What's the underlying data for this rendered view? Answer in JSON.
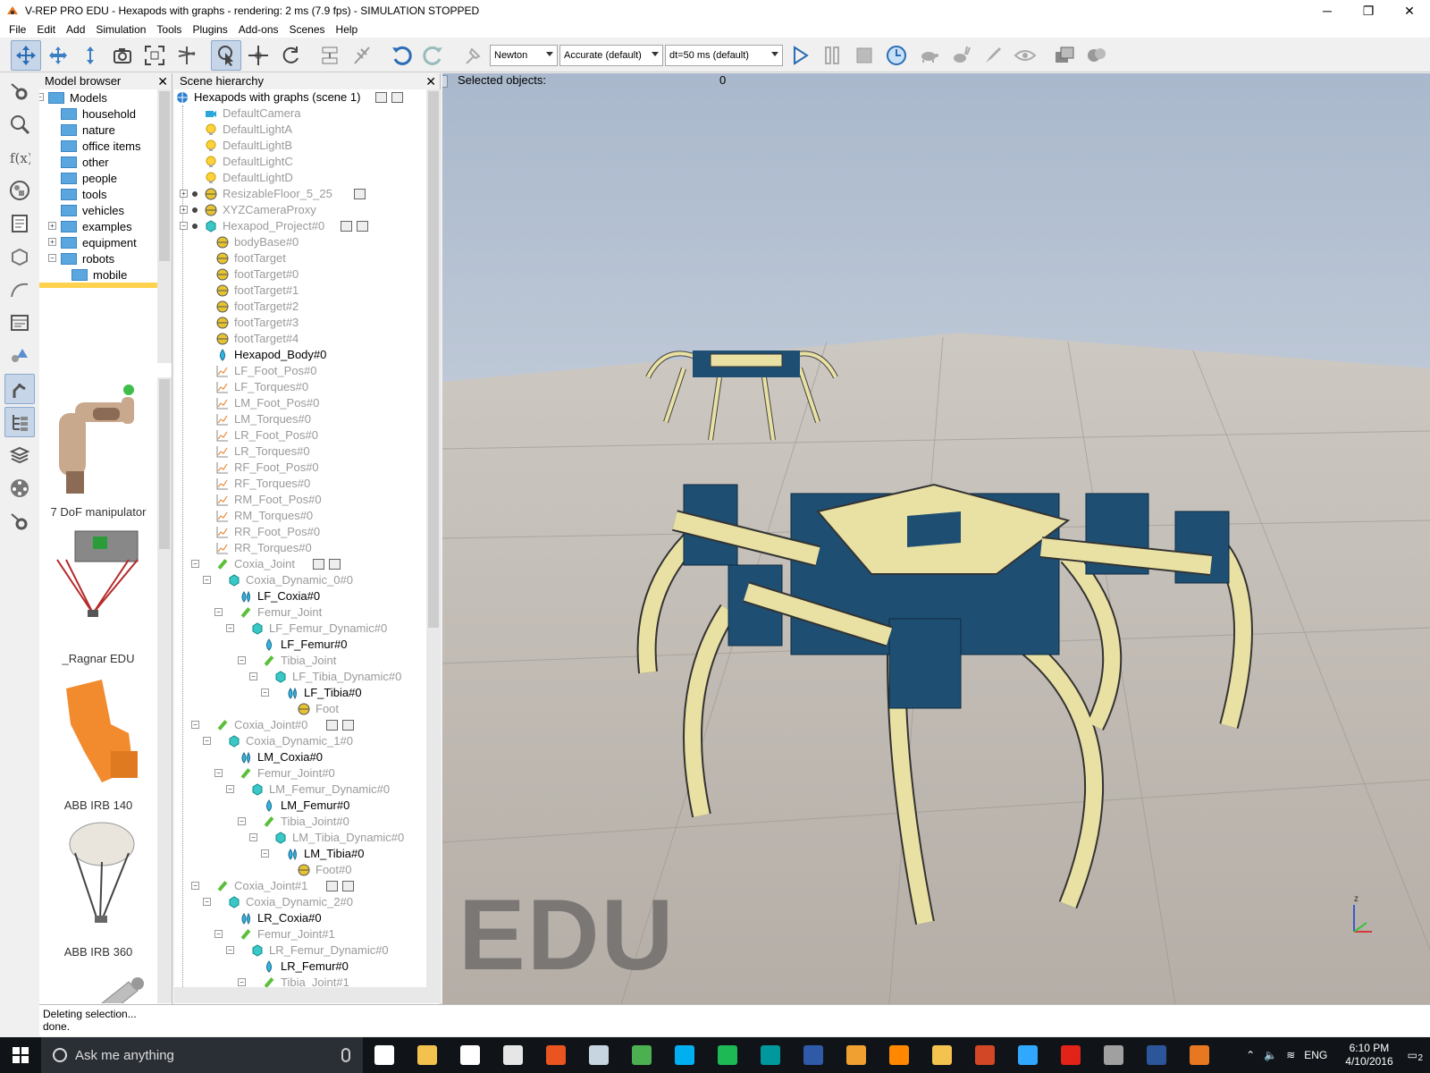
{
  "window": {
    "title": "V-REP PRO EDU - Hexapods with graphs - rendering: 2 ms (7.9 fps) - SIMULATION STOPPED",
    "minimize": "─",
    "maximize": "❐",
    "close": "✕"
  },
  "menu": [
    "File",
    "Edit",
    "Add",
    "Simulation",
    "Tools",
    "Plugins",
    "Add-ons",
    "Scenes",
    "Help"
  ],
  "toolbar": {
    "engine": "Newton",
    "accuracy": "Accurate (default)",
    "timestep": "dt=50 ms (default)"
  },
  "model_browser": {
    "title": "Model browser",
    "close": "✕",
    "tree": [
      {
        "label": "Models",
        "expander": "−"
      },
      {
        "label": "household"
      },
      {
        "label": "nature"
      },
      {
        "label": "office items"
      },
      {
        "label": "other"
      },
      {
        "label": "people"
      },
      {
        "label": "tools"
      },
      {
        "label": "vehicles"
      },
      {
        "label": "examples",
        "expander": "+"
      },
      {
        "label": "equipment",
        "expander": "+"
      },
      {
        "label": "robots",
        "expander": "−"
      },
      {
        "label": "mobile"
      }
    ],
    "models": [
      {
        "label": "7 DoF manipulator"
      },
      {
        "label": "_Ragnar EDU"
      },
      {
        "label": "ABB IRB 140"
      },
      {
        "label": "ABB IRB 360"
      },
      {
        "label": ""
      }
    ]
  },
  "hierarchy": {
    "title": "Scene hierarchy",
    "close": "✕",
    "scene_label": "Hexapods with graphs (scene 1)",
    "rows": [
      {
        "label": "DefaultCamera",
        "depth": 1,
        "icon": "camera",
        "dim": true
      },
      {
        "label": "DefaultLightA",
        "depth": 1,
        "icon": "light",
        "dim": true
      },
      {
        "label": "DefaultLightB",
        "depth": 1,
        "icon": "light",
        "dim": true
      },
      {
        "label": "DefaultLightC",
        "depth": 1,
        "icon": "light",
        "dim": true
      },
      {
        "label": "DefaultLightD",
        "depth": 1,
        "icon": "light",
        "dim": true
      },
      {
        "label": "ResizableFloor_5_25",
        "depth": 1,
        "icon": "dummy",
        "dim": true,
        "exp": "+",
        "dot": true,
        "badges": 1
      },
      {
        "label": "XYZCameraProxy",
        "depth": 1,
        "icon": "dummy",
        "dim": true,
        "exp": "+",
        "dot": true
      },
      {
        "label": "Hexapod_Project#0",
        "depth": 1,
        "icon": "shape",
        "dim": true,
        "exp": "−",
        "dot": true,
        "badges": 2
      },
      {
        "label": "bodyBase#0",
        "depth": 2,
        "icon": "dummy",
        "dim": true
      },
      {
        "label": "footTarget",
        "depth": 2,
        "icon": "dummy",
        "dim": true
      },
      {
        "label": "footTarget#0",
        "depth": 2,
        "icon": "dummy",
        "dim": true
      },
      {
        "label": "footTarget#1",
        "depth": 2,
        "icon": "dummy",
        "dim": true
      },
      {
        "label": "footTarget#2",
        "depth": 2,
        "icon": "dummy",
        "dim": true
      },
      {
        "label": "footTarget#3",
        "depth": 2,
        "icon": "dummy",
        "dim": true
      },
      {
        "label": "footTarget#4",
        "depth": 2,
        "icon": "dummy",
        "dim": true
      },
      {
        "label": "Hexapod_Body#0",
        "depth": 2,
        "icon": "drop",
        "dim": false
      },
      {
        "label": "LF_Foot_Pos#0",
        "depth": 2,
        "icon": "graph",
        "dim": true
      },
      {
        "label": "LF_Torques#0",
        "depth": 2,
        "icon": "graph",
        "dim": true
      },
      {
        "label": "LM_Foot_Pos#0",
        "depth": 2,
        "icon": "graph",
        "dim": true
      },
      {
        "label": "LM_Torques#0",
        "depth": 2,
        "icon": "graph",
        "dim": true
      },
      {
        "label": "LR_Foot_Pos#0",
        "depth": 2,
        "icon": "graph",
        "dim": true
      },
      {
        "label": "LR_Torques#0",
        "depth": 2,
        "icon": "graph",
        "dim": true
      },
      {
        "label": "RF_Foot_Pos#0",
        "depth": 2,
        "icon": "graph",
        "dim": true
      },
      {
        "label": "RF_Torques#0",
        "depth": 2,
        "icon": "graph",
        "dim": true
      },
      {
        "label": "RM_Foot_Pos#0",
        "depth": 2,
        "icon": "graph",
        "dim": true
      },
      {
        "label": "RM_Torques#0",
        "depth": 2,
        "icon": "graph",
        "dim": true
      },
      {
        "label": "RR_Foot_Pos#0",
        "depth": 2,
        "icon": "graph",
        "dim": true
      },
      {
        "label": "RR_Torques#0",
        "depth": 2,
        "icon": "graph",
        "dim": true
      },
      {
        "label": "Coxia_Joint",
        "depth": 2,
        "icon": "joint",
        "dim": true,
        "exp": "−",
        "badges": 2
      },
      {
        "label": "Coxia_Dynamic_0#0",
        "depth": 3,
        "icon": "shape",
        "dim": true,
        "exp": "−"
      },
      {
        "label": "LF_Coxia#0",
        "depth": 4,
        "icon": "drops",
        "dim": false
      },
      {
        "label": "Femur_Joint",
        "depth": 4,
        "icon": "joint",
        "dim": true,
        "exp": "−"
      },
      {
        "label": "LF_Femur_Dynamic#0",
        "depth": 5,
        "icon": "shape",
        "dim": true,
        "exp": "−"
      },
      {
        "label": "LF_Femur#0",
        "depth": 6,
        "icon": "drop",
        "dim": false
      },
      {
        "label": "Tibia_Joint",
        "depth": 6,
        "icon": "joint",
        "dim": true,
        "exp": "−"
      },
      {
        "label": "LF_Tibia_Dynamic#0",
        "depth": 7,
        "icon": "shape",
        "dim": true,
        "exp": "−"
      },
      {
        "label": "LF_Tibia#0",
        "depth": 8,
        "icon": "drops",
        "dim": false,
        "exp": "−"
      },
      {
        "label": "Foot",
        "depth": 9,
        "icon": "dummy",
        "dim": true
      },
      {
        "label": "Coxia_Joint#0",
        "depth": 2,
        "icon": "joint",
        "dim": true,
        "exp": "−",
        "badges": 2
      },
      {
        "label": "Coxia_Dynamic_1#0",
        "depth": 3,
        "icon": "shape",
        "dim": true,
        "exp": "−"
      },
      {
        "label": "LM_Coxia#0",
        "depth": 4,
        "icon": "drops",
        "dim": false
      },
      {
        "label": "Femur_Joint#0",
        "depth": 4,
        "icon": "joint",
        "dim": true,
        "exp": "−"
      },
      {
        "label": "LM_Femur_Dynamic#0",
        "depth": 5,
        "icon": "shape",
        "dim": true,
        "exp": "−"
      },
      {
        "label": "LM_Femur#0",
        "depth": 6,
        "icon": "drop",
        "dim": false
      },
      {
        "label": "Tibia_Joint#0",
        "depth": 6,
        "icon": "joint",
        "dim": true,
        "exp": "−"
      },
      {
        "label": "LM_Tibia_Dynamic#0",
        "depth": 7,
        "icon": "shape",
        "dim": true,
        "exp": "−"
      },
      {
        "label": "LM_Tibia#0",
        "depth": 8,
        "icon": "drops",
        "dim": false,
        "exp": "−"
      },
      {
        "label": "Foot#0",
        "depth": 9,
        "icon": "dummy",
        "dim": true
      },
      {
        "label": "Coxia_Joint#1",
        "depth": 2,
        "icon": "joint",
        "dim": true,
        "exp": "−",
        "badges": 2
      },
      {
        "label": "Coxia_Dynamic_2#0",
        "depth": 3,
        "icon": "shape",
        "dim": true,
        "exp": "−"
      },
      {
        "label": "LR_Coxia#0",
        "depth": 4,
        "icon": "drops",
        "dim": false
      },
      {
        "label": "Femur_Joint#1",
        "depth": 4,
        "icon": "joint",
        "dim": true,
        "exp": "−"
      },
      {
        "label": "LR_Femur_Dynamic#0",
        "depth": 5,
        "icon": "shape",
        "dim": true,
        "exp": "−"
      },
      {
        "label": "LR_Femur#0",
        "depth": 6,
        "icon": "drop",
        "dim": false
      },
      {
        "label": "Tibia_Joint#1",
        "depth": 6,
        "icon": "joint",
        "dim": true,
        "exp": "−"
      }
    ]
  },
  "viewport": {
    "selected_label": "Selected objects:",
    "selected_count": "0",
    "watermark": "EDU",
    "axis_z": "z"
  },
  "status": {
    "line1": "Deleting selection...",
    "line2": "done."
  },
  "taskbar": {
    "search_placeholder": "Ask me anything",
    "tray_lang": "ENG",
    "time": "6:10 PM",
    "date": "4/10/2016",
    "notif_count": "2",
    "apps": [
      {
        "name": "task-view",
        "color": "#ffffff"
      },
      {
        "name": "file-explorer",
        "color": "#f2c14e"
      },
      {
        "name": "store",
        "color": "#ffffff"
      },
      {
        "name": "calculator",
        "color": "#e6e6e6"
      },
      {
        "name": "ubuntu",
        "color": "#e95420"
      },
      {
        "name": "steam",
        "color": "#c7d5e0"
      },
      {
        "name": "chrome",
        "color": "#4caf50"
      },
      {
        "name": "skype",
        "color": "#00aff0"
      },
      {
        "name": "spotify",
        "color": "#1db954"
      },
      {
        "name": "arduino",
        "color": "#00979d"
      },
      {
        "name": "app-blue",
        "color": "#2f5aa8"
      },
      {
        "name": "dlink",
        "color": "#f0a030"
      },
      {
        "name": "vlc",
        "color": "#ff8800"
      },
      {
        "name": "pen",
        "color": "#f3c24f"
      },
      {
        "name": "powerpoint",
        "color": "#d24726"
      },
      {
        "name": "photoshop",
        "color": "#31a8ff"
      },
      {
        "name": "solidworks",
        "color": "#e2231a"
      },
      {
        "name": "app-settings",
        "color": "#a0a0a0"
      },
      {
        "name": "word",
        "color": "#2b579a"
      },
      {
        "name": "vrep",
        "color": "#e87722"
      }
    ]
  }
}
